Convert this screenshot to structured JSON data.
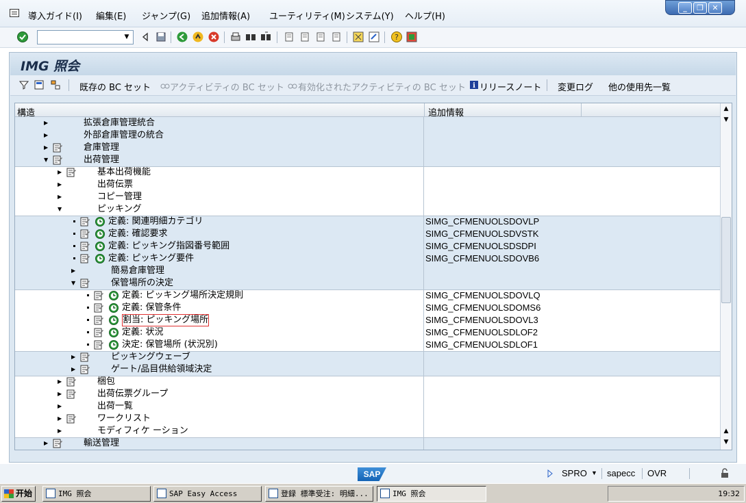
{
  "menubar": {
    "items": [
      "導入ガイド(I)",
      "編集(E)",
      "ジャンプ(G)",
      "追加情報(A)",
      "ユーティリティ(M)",
      "システム(Y)",
      "ヘルプ(H)"
    ],
    "win_controls": [
      "_",
      "❐",
      "✕"
    ]
  },
  "toolbar": {
    "command_field_value": ""
  },
  "screen": {
    "title": "IMG 照会"
  },
  "app_toolbar": {
    "existing_bc_sets": "既存の BC セット",
    "activity_bc_sets": "アクティビティの BC セット",
    "activated_bc_sets": "有効化されたアクティビティの BC セット",
    "release_notes": "リリースノート",
    "change_log": "変更ログ",
    "where_used": "他の使用先一覧"
  },
  "tree": {
    "col_structure": "構造",
    "col_additional": "追加情報",
    "rows": [
      {
        "label": "拡張倉庫管理統合",
        "info": ""
      },
      {
        "label": "外部倉庫管理の統合",
        "info": ""
      },
      {
        "label": "倉庫管理",
        "info": ""
      },
      {
        "label": "出荷管理",
        "info": ""
      },
      {
        "label": "基本出荷機能",
        "info": ""
      },
      {
        "label": "出荷伝票",
        "info": ""
      },
      {
        "label": "コピー管理",
        "info": ""
      },
      {
        "label": "ピッキング",
        "info": ""
      },
      {
        "label": "定義: 関連明細カテゴリ",
        "info": "SIMG_CFMENUOLSDOVLP"
      },
      {
        "label": "定義: 確認要求",
        "info": "SIMG_CFMENUOLSDVSTK"
      },
      {
        "label": "定義: ピッキング指図番号範囲",
        "info": "SIMG_CFMENUOLSDSDPI"
      },
      {
        "label": "定義: ピッキング要件",
        "info": "SIMG_CFMENUOLSDOVB6"
      },
      {
        "label": "簡易倉庫管理",
        "info": ""
      },
      {
        "label": "保管場所の決定",
        "info": ""
      },
      {
        "label": "定義: ピッキング場所決定規則",
        "info": "SIMG_CFMENUOLSDOVLQ"
      },
      {
        "label": "定義: 保管条件",
        "info": "SIMG_CFMENUOLSDOMS6"
      },
      {
        "label": "割当: ピッキング場所",
        "info": "SIMG_CFMENUOLSDOVL3"
      },
      {
        "label": "定義: 状況",
        "info": "SIMG_CFMENUOLSDLOF2"
      },
      {
        "label": "決定: 保管場所 (状況別)",
        "info": "SIMG_CFMENUOLSDLOF1"
      },
      {
        "label": "ピッキングウェーブ",
        "info": ""
      },
      {
        "label": "ゲート/品目供給領域決定",
        "info": ""
      },
      {
        "label": "梱包",
        "info": ""
      },
      {
        "label": "出荷伝票グループ",
        "info": ""
      },
      {
        "label": "出荷一覧",
        "info": ""
      },
      {
        "label": "ワークリスト",
        "info": ""
      },
      {
        "label": "モディフィケ ーション",
        "info": ""
      },
      {
        "label": "輸送管理",
        "info": ""
      }
    ]
  },
  "statusbar": {
    "logo": "SAP",
    "transaction": "SPRO",
    "system": "sapecc",
    "mode": "OVR"
  },
  "taskbar": {
    "start": "开始",
    "tasks": [
      "IMG 照会",
      "SAP Easy Access",
      "登録 標準受注: 明細...",
      "IMG 照会"
    ],
    "clock": "19:32"
  }
}
